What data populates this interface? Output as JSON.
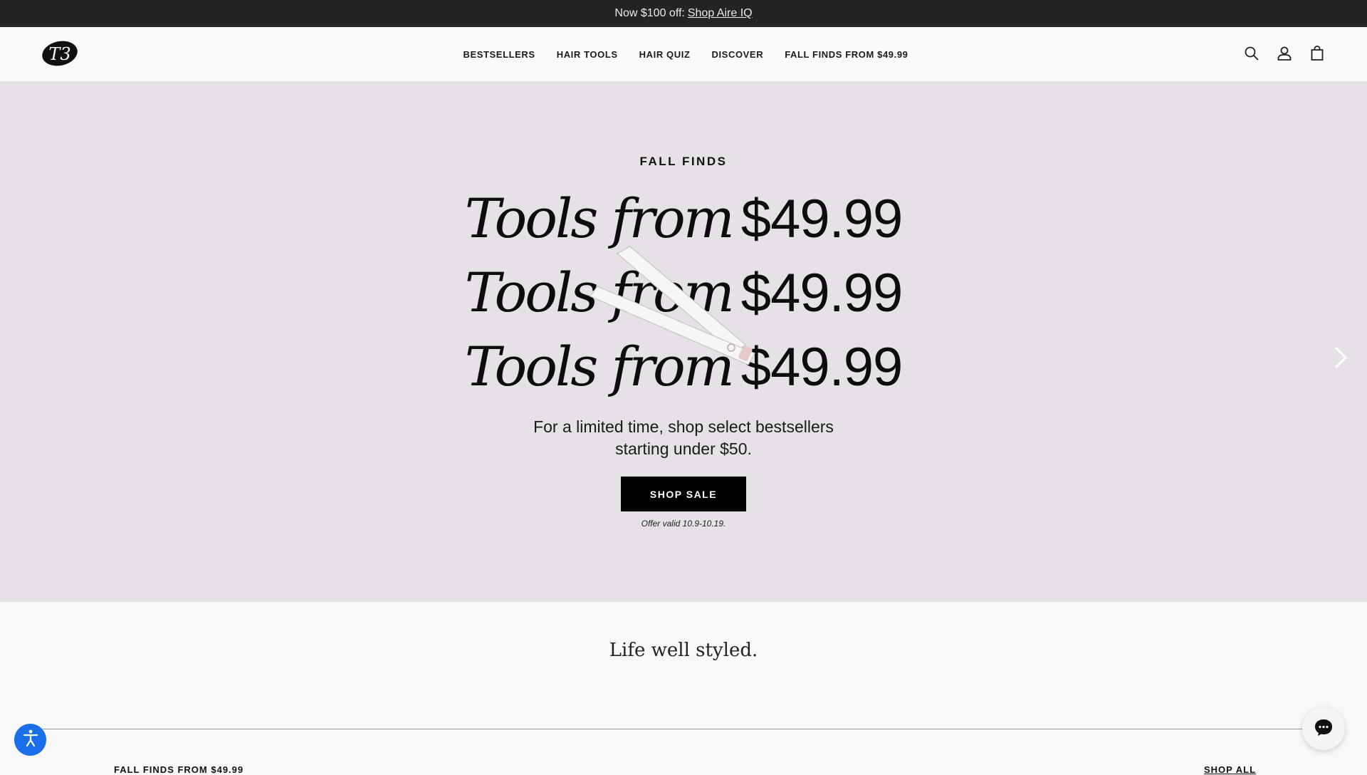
{
  "announcement": {
    "prefix": "Now $100 off:",
    "link": "Shop Aire IQ"
  },
  "header": {
    "logo_text": "T3",
    "nav": [
      "BESTSELLERS",
      "HAIR TOOLS",
      "HAIR QUIZ",
      "DISCOVER",
      "FALL FINDS FROM $49.99"
    ],
    "icons": [
      "search-icon",
      "account-icon",
      "bag-icon"
    ]
  },
  "hero": {
    "eyebrow": "FALL FINDS",
    "headline_lines": [
      {
        "italic": "Tools from",
        "price": "$49.99"
      },
      {
        "italic": "Tools from",
        "price": "$49.99"
      },
      {
        "italic": "Tools from",
        "price": "$49.99"
      }
    ],
    "subtext": [
      "For a limited time, shop select bestsellers",
      "starting under $50."
    ],
    "cta": "SHOP SALE",
    "note": "Offer valid 10.9-10.19.",
    "background": "#e5e1e6"
  },
  "section": {
    "tagline": "Life well styled.",
    "row_title": "FALL FINDS FROM $49.99",
    "shop_all": "SHOP ALL"
  },
  "widgets": {
    "accessibility": "accessibility-icon",
    "chat": "chat-icon"
  },
  "colors": {
    "announcement_bg": "#242424",
    "accent_blue": "#1a6fe8",
    "cta_bg": "#000000"
  }
}
